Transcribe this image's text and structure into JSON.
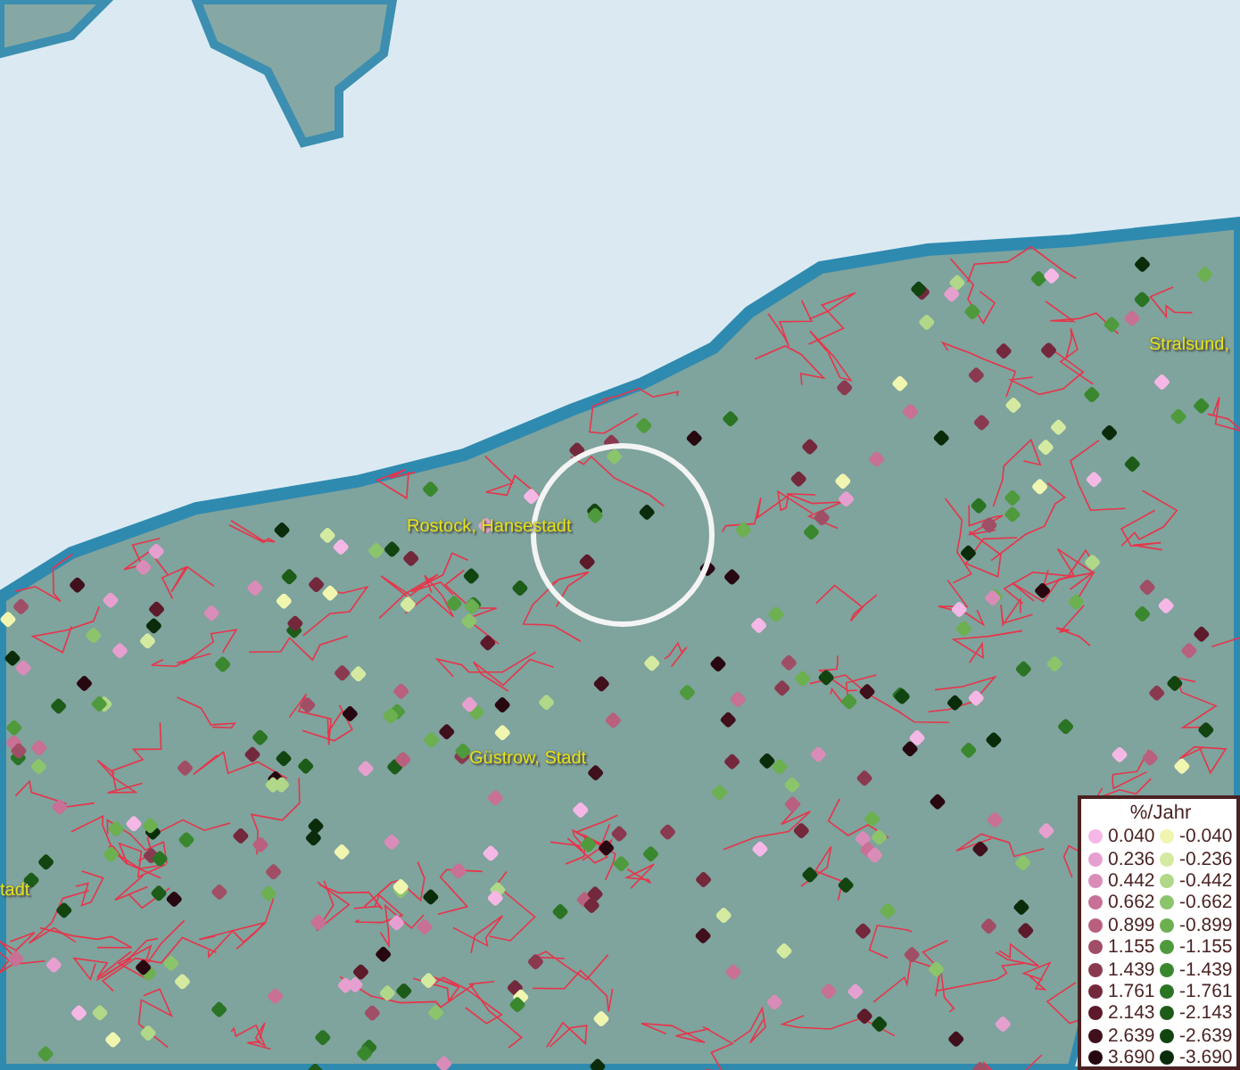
{
  "map": {
    "place_labels": [
      {
        "text": "Stralsund,"
      },
      {
        "text": "Rostock, Hansestadt"
      },
      {
        "text": "Güstrow, Stadt"
      },
      {
        "text": "tadt"
      }
    ]
  },
  "legend": {
    "title": "%/Jahr",
    "entries": [
      {
        "label": "0.040",
        "color": "#f5b8e6"
      },
      {
        "label": "-0.040",
        "color": "#f0f5b0"
      },
      {
        "label": "0.236",
        "color": "#e6a0cf"
      },
      {
        "label": "-0.236",
        "color": "#d4eaa0"
      },
      {
        "label": "0.442",
        "color": "#d98cb8"
      },
      {
        "label": "-0.442",
        "color": "#b0d888"
      },
      {
        "label": "0.662",
        "color": "#c87095"
      },
      {
        "label": "-0.662",
        "color": "#8cc46c"
      },
      {
        "label": "0.899",
        "color": "#b8607e"
      },
      {
        "label": "-0.899",
        "color": "#6cb050"
      },
      {
        "label": "1.155",
        "color": "#a04e66"
      },
      {
        "label": "-1.155",
        "color": "#4e9a3c"
      },
      {
        "label": "1.439",
        "color": "#8a3a50"
      },
      {
        "label": "-1.439",
        "color": "#3a882e"
      },
      {
        "label": "1.761",
        "color": "#74283c"
      },
      {
        "label": "-1.761",
        "color": "#2a7424"
      },
      {
        "label": "2.143",
        "color": "#5c1a2a"
      },
      {
        "label": "-2.143",
        "color": "#1c5c18"
      },
      {
        "label": "2.639",
        "color": "#40101c"
      },
      {
        "label": "-2.639",
        "color": "#124410"
      },
      {
        "label": "3.690",
        "color": "#280810"
      },
      {
        "label": "-3.690",
        "color": "#0a2c0a"
      }
    ]
  }
}
